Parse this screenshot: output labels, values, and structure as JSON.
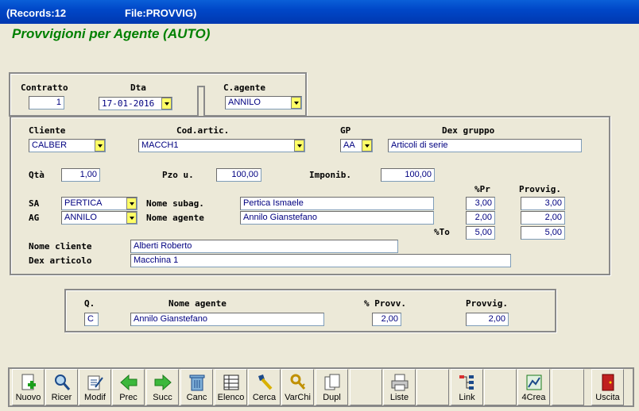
{
  "window": {
    "records": "(Records:12",
    "file": "File:PROVVIG)"
  },
  "header": {
    "title": "Provvigioni per Agente (AUTO)"
  },
  "top": {
    "contratto_label": "Contratto",
    "contratto_value": "1",
    "dta_label": "Dta",
    "dta_value": "17-01-2016",
    "cagente_label": "C.agente",
    "cagente_value": "ANNILO"
  },
  "main": {
    "cliente_label": "Cliente",
    "cliente_value": "CALBER",
    "codartic_label": "Cod.artic.",
    "codartic_value": "MACCH1",
    "gp_label": "GP",
    "gp_value": "AA",
    "dexgruppo_label": "Dex gruppo",
    "dexgruppo_value": "Articoli di serie",
    "qta_label": "Qtà",
    "qta_value": "1,00",
    "pzo_label": "Pzo u.",
    "pzo_value": "100,00",
    "imponib_label": "Imponib.",
    "imponib_value": "100,00",
    "pr_label": "%Pr",
    "provvig_label": "Provvig.",
    "sa_label": "SA",
    "sa_value": "PERTICA",
    "nomesubag_label": "Nome subag.",
    "nomesubag_value": "Pertica Ismaele",
    "sa_pr": "3,00",
    "sa_provvig": "3,00",
    "ag_label": "AG",
    "ag_value": "ANNILO",
    "nomeagente_label": "Nome agente",
    "nomeagente_value": "Annilo Gianstefano",
    "ag_pr": "2,00",
    "ag_provvig": "2,00",
    "to_label": "%To",
    "to_pr": "5,00",
    "to_provvig": "5,00",
    "nomecliente_label": "Nome cliente",
    "nomecliente_value": "Alberti Roberto",
    "dexarticolo_label": "Dex articolo",
    "dexarticolo_value": "Macchina 1"
  },
  "bottom": {
    "q_label": "Q.",
    "q_value": "C",
    "nomeagente_label": "Nome agente",
    "nomeagente_value": "Annilo Gianstefano",
    "pprovv_label": "% Provv.",
    "pprovv_value": "2,00",
    "provvig_label": "Provvig.",
    "provvig_value": "2,00"
  },
  "toolbar": {
    "nuovo": "Nuovo",
    "ricer": "Ricer",
    "modif": "Modif",
    "prec": "Prec",
    "succ": "Succ",
    "canc": "Canc",
    "elenco": "Elenco",
    "cerca": "Cerca",
    "varchi": "VarChi",
    "dupl": "Dupl",
    "liste": "Liste",
    "link": "Link",
    "crea": "4Crea",
    "uscita": "Uscita"
  }
}
